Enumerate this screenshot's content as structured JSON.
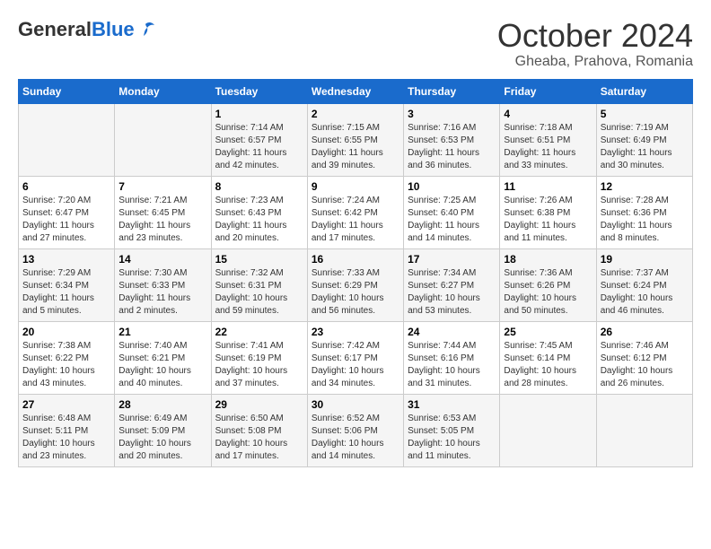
{
  "header": {
    "logo_general": "General",
    "logo_blue": "Blue",
    "month": "October 2024",
    "location": "Gheaba, Prahova, Romania"
  },
  "weekdays": [
    "Sunday",
    "Monday",
    "Tuesday",
    "Wednesday",
    "Thursday",
    "Friday",
    "Saturday"
  ],
  "weeks": [
    [
      {
        "day": "",
        "sunrise": "",
        "sunset": "",
        "daylight": ""
      },
      {
        "day": "",
        "sunrise": "",
        "sunset": "",
        "daylight": ""
      },
      {
        "day": "1",
        "sunrise": "Sunrise: 7:14 AM",
        "sunset": "Sunset: 6:57 PM",
        "daylight": "Daylight: 11 hours and 42 minutes."
      },
      {
        "day": "2",
        "sunrise": "Sunrise: 7:15 AM",
        "sunset": "Sunset: 6:55 PM",
        "daylight": "Daylight: 11 hours and 39 minutes."
      },
      {
        "day": "3",
        "sunrise": "Sunrise: 7:16 AM",
        "sunset": "Sunset: 6:53 PM",
        "daylight": "Daylight: 11 hours and 36 minutes."
      },
      {
        "day": "4",
        "sunrise": "Sunrise: 7:18 AM",
        "sunset": "Sunset: 6:51 PM",
        "daylight": "Daylight: 11 hours and 33 minutes."
      },
      {
        "day": "5",
        "sunrise": "Sunrise: 7:19 AM",
        "sunset": "Sunset: 6:49 PM",
        "daylight": "Daylight: 11 hours and 30 minutes."
      }
    ],
    [
      {
        "day": "6",
        "sunrise": "Sunrise: 7:20 AM",
        "sunset": "Sunset: 6:47 PM",
        "daylight": "Daylight: 11 hours and 27 minutes."
      },
      {
        "day": "7",
        "sunrise": "Sunrise: 7:21 AM",
        "sunset": "Sunset: 6:45 PM",
        "daylight": "Daylight: 11 hours and 23 minutes."
      },
      {
        "day": "8",
        "sunrise": "Sunrise: 7:23 AM",
        "sunset": "Sunset: 6:43 PM",
        "daylight": "Daylight: 11 hours and 20 minutes."
      },
      {
        "day": "9",
        "sunrise": "Sunrise: 7:24 AM",
        "sunset": "Sunset: 6:42 PM",
        "daylight": "Daylight: 11 hours and 17 minutes."
      },
      {
        "day": "10",
        "sunrise": "Sunrise: 7:25 AM",
        "sunset": "Sunset: 6:40 PM",
        "daylight": "Daylight: 11 hours and 14 minutes."
      },
      {
        "day": "11",
        "sunrise": "Sunrise: 7:26 AM",
        "sunset": "Sunset: 6:38 PM",
        "daylight": "Daylight: 11 hours and 11 minutes."
      },
      {
        "day": "12",
        "sunrise": "Sunrise: 7:28 AM",
        "sunset": "Sunset: 6:36 PM",
        "daylight": "Daylight: 11 hours and 8 minutes."
      }
    ],
    [
      {
        "day": "13",
        "sunrise": "Sunrise: 7:29 AM",
        "sunset": "Sunset: 6:34 PM",
        "daylight": "Daylight: 11 hours and 5 minutes."
      },
      {
        "day": "14",
        "sunrise": "Sunrise: 7:30 AM",
        "sunset": "Sunset: 6:33 PM",
        "daylight": "Daylight: 11 hours and 2 minutes."
      },
      {
        "day": "15",
        "sunrise": "Sunrise: 7:32 AM",
        "sunset": "Sunset: 6:31 PM",
        "daylight": "Daylight: 10 hours and 59 minutes."
      },
      {
        "day": "16",
        "sunrise": "Sunrise: 7:33 AM",
        "sunset": "Sunset: 6:29 PM",
        "daylight": "Daylight: 10 hours and 56 minutes."
      },
      {
        "day": "17",
        "sunrise": "Sunrise: 7:34 AM",
        "sunset": "Sunset: 6:27 PM",
        "daylight": "Daylight: 10 hours and 53 minutes."
      },
      {
        "day": "18",
        "sunrise": "Sunrise: 7:36 AM",
        "sunset": "Sunset: 6:26 PM",
        "daylight": "Daylight: 10 hours and 50 minutes."
      },
      {
        "day": "19",
        "sunrise": "Sunrise: 7:37 AM",
        "sunset": "Sunset: 6:24 PM",
        "daylight": "Daylight: 10 hours and 46 minutes."
      }
    ],
    [
      {
        "day": "20",
        "sunrise": "Sunrise: 7:38 AM",
        "sunset": "Sunset: 6:22 PM",
        "daylight": "Daylight: 10 hours and 43 minutes."
      },
      {
        "day": "21",
        "sunrise": "Sunrise: 7:40 AM",
        "sunset": "Sunset: 6:21 PM",
        "daylight": "Daylight: 10 hours and 40 minutes."
      },
      {
        "day": "22",
        "sunrise": "Sunrise: 7:41 AM",
        "sunset": "Sunset: 6:19 PM",
        "daylight": "Daylight: 10 hours and 37 minutes."
      },
      {
        "day": "23",
        "sunrise": "Sunrise: 7:42 AM",
        "sunset": "Sunset: 6:17 PM",
        "daylight": "Daylight: 10 hours and 34 minutes."
      },
      {
        "day": "24",
        "sunrise": "Sunrise: 7:44 AM",
        "sunset": "Sunset: 6:16 PM",
        "daylight": "Daylight: 10 hours and 31 minutes."
      },
      {
        "day": "25",
        "sunrise": "Sunrise: 7:45 AM",
        "sunset": "Sunset: 6:14 PM",
        "daylight": "Daylight: 10 hours and 28 minutes."
      },
      {
        "day": "26",
        "sunrise": "Sunrise: 7:46 AM",
        "sunset": "Sunset: 6:12 PM",
        "daylight": "Daylight: 10 hours and 26 minutes."
      }
    ],
    [
      {
        "day": "27",
        "sunrise": "Sunrise: 6:48 AM",
        "sunset": "Sunset: 5:11 PM",
        "daylight": "Daylight: 10 hours and 23 minutes."
      },
      {
        "day": "28",
        "sunrise": "Sunrise: 6:49 AM",
        "sunset": "Sunset: 5:09 PM",
        "daylight": "Daylight: 10 hours and 20 minutes."
      },
      {
        "day": "29",
        "sunrise": "Sunrise: 6:50 AM",
        "sunset": "Sunset: 5:08 PM",
        "daylight": "Daylight: 10 hours and 17 minutes."
      },
      {
        "day": "30",
        "sunrise": "Sunrise: 6:52 AM",
        "sunset": "Sunset: 5:06 PM",
        "daylight": "Daylight: 10 hours and 14 minutes."
      },
      {
        "day": "31",
        "sunrise": "Sunrise: 6:53 AM",
        "sunset": "Sunset: 5:05 PM",
        "daylight": "Daylight: 10 hours and 11 minutes."
      },
      {
        "day": "",
        "sunrise": "",
        "sunset": "",
        "daylight": ""
      },
      {
        "day": "",
        "sunrise": "",
        "sunset": "",
        "daylight": ""
      }
    ]
  ]
}
